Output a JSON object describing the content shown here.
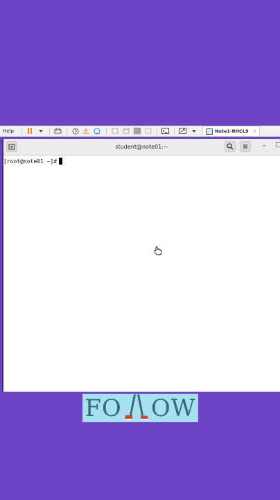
{
  "vm_toolbar": {
    "help_label": "Help",
    "tab_label": "Note1-RHCL9",
    "tab_close": "×"
  },
  "terminal": {
    "title": "student@note01:~",
    "prompt": "[root@note01 ~]#",
    "minimize_glyph": "–",
    "maximize_glyph": "□"
  },
  "follow_banner": {
    "text_left": "FO",
    "text_right": "OW"
  },
  "colors": {
    "background": "#6b45c6",
    "banner_bg": "#a9dff2",
    "banner_text": "#2e6f73"
  }
}
